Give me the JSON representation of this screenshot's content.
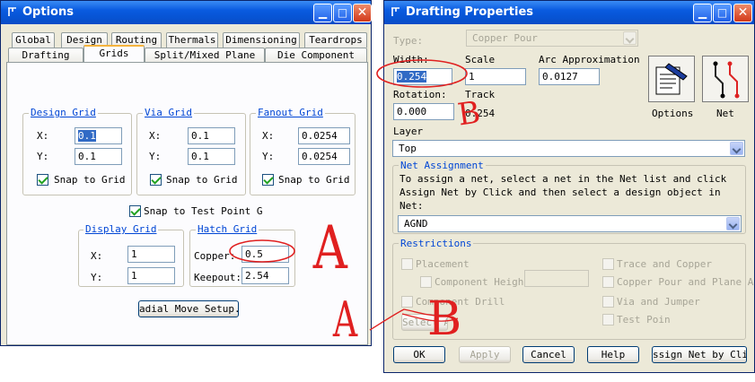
{
  "options_window": {
    "title": "Options",
    "tabs_row1": [
      "Global",
      "Design",
      "Routing",
      "Thermals",
      "Dimensioning",
      "Teardrops"
    ],
    "tabs_row2": [
      "Drafting",
      "Grids",
      "Split/Mixed Plane",
      "Die Component"
    ],
    "design_grid": {
      "label": "Design Grid",
      "x_label": "X:",
      "x_value": "0.1",
      "y_label": "Y:",
      "y_value": "0.1",
      "snap_label": "Snap to Grid"
    },
    "via_grid": {
      "label": "Via Grid",
      "x_label": "X:",
      "x_value": "0.1",
      "y_label": "Y:",
      "y_value": "0.1",
      "snap_label": "Snap to Grid"
    },
    "fanout_grid": {
      "label": "Fanout Grid",
      "x_label": "X:",
      "x_value": "0.0254",
      "y_label": "Y:",
      "y_value": "0.0254",
      "snap_label": "Snap to Grid"
    },
    "snap_test_point_label": "Snap to Test Point G",
    "display_grid": {
      "label": "Display Grid",
      "x_label": "X:",
      "x_value": "1",
      "y_label": "Y:",
      "y_value": "1"
    },
    "hatch_grid": {
      "label": "Hatch Grid",
      "copper_label": "Copper:",
      "copper_value": "0.5",
      "keepout_label": "Keepout:",
      "keepout_value": "2.54"
    },
    "radial_button": "adial Move Setup.."
  },
  "drafting_window": {
    "title": "Drafting Properties",
    "type_label": "Type:",
    "type_value": "Copper Pour",
    "width_label": "Width:",
    "width_value": "0.254",
    "scale_label": "Scale",
    "scale_value": "1",
    "arc_label": "Arc Approximation",
    "arc_value": "0.0127",
    "rotation_label": "Rotation:",
    "rotation_value": "0.000",
    "track_label": "Track",
    "track_value": "0.254",
    "options_btn_label": "Options",
    "net_btn_label": "Net",
    "layer_label": "Layer",
    "layer_value": "Top",
    "net_assignment": {
      "label": "Net Assignment",
      "line1": "To assign a net, select a net in the Net list and click",
      "line2": "Assign Net by Click and then select a design object in",
      "net_label": "Net:",
      "net_value": "AGND"
    },
    "restrictions": {
      "label": "Restrictions",
      "placement": "Placement",
      "component_height": "Component Height",
      "component_drill": "Component Drill",
      "select_all": "Select All",
      "trace_and_copper": "Trace and Copper",
      "copper_pour_plane": "Copper Pour and Plane Ar",
      "via_and_jumper": "Via and Jumper",
      "test_point": "Test Poin"
    },
    "buttons": {
      "ok": "OK",
      "apply": "Apply",
      "cancel": "Cancel",
      "help": "Help",
      "assign": "ssign Net by Clic"
    }
  },
  "annotations": {
    "a_big": "A",
    "a_small": "A",
    "b_big": "B",
    "b_small": "B"
  },
  "colors": {
    "title_bar": "#0a5be0",
    "window_bg": "#ece9d8",
    "annotation_red": "#e02020",
    "group_label": "#0046d5"
  }
}
